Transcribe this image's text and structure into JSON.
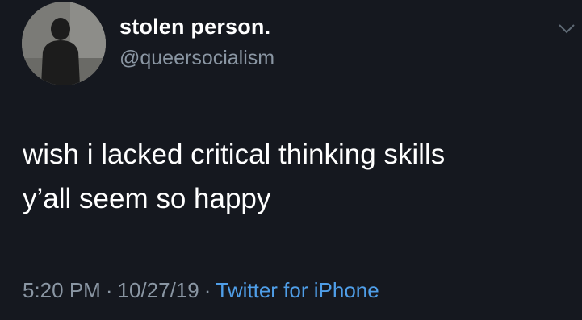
{
  "tweet": {
    "display_name": "stolen person.",
    "handle": "@queersocialism",
    "text_lines": [
      "wish i lacked critical thinking skills",
      "y’all seem so happy"
    ],
    "time": "5:20 PM",
    "date": "10/27/19",
    "separator": "·",
    "source": "Twitter for iPhone",
    "icons": {
      "avatar": "avatar-photo",
      "menu": "chevron-down-icon"
    }
  },
  "colors": {
    "background": "#15181f",
    "text": "#ffffff",
    "secondary_text": "#8a96a3",
    "link": "#4f9ee8"
  }
}
